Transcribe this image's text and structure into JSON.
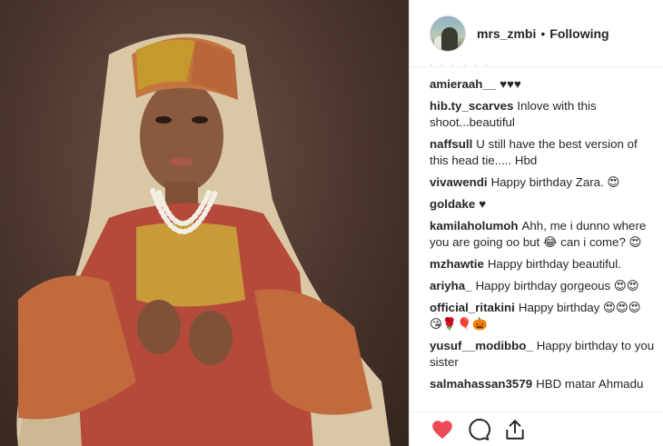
{
  "header": {
    "username": "mrs_zmbi",
    "separator": "•",
    "follow_status": "Following"
  },
  "comments": [
    {
      "user": "amieraah__",
      "text": "♥♥♥"
    },
    {
      "user": "hib.ty_scarves",
      "text": "Inlove with this shoot...beautiful"
    },
    {
      "user": "naffsull",
      "text": "U still have the best version of this head tie..... Hbd"
    },
    {
      "user": "vivawendi",
      "text": "Happy birthday Zara. 😍"
    },
    {
      "user": "goldake",
      "text": "♥"
    },
    {
      "user": "kamilaholumoh",
      "text": "Ahh, me i dunno where you are going oo but 😂 can i come? 😍"
    },
    {
      "user": "mzhawtie",
      "text": "Happy birthday beautiful."
    },
    {
      "user": "ariyha_",
      "text": "Happy birthday gorgeous 😍😍"
    },
    {
      "user": "official_ritakini",
      "text": "Happy birthday 😍😍😍 😘🌹🎈🎃"
    },
    {
      "user": "yusuf__modibbo_",
      "text": "Happy birthday to you sister"
    },
    {
      "user": "salmahassan3579",
      "text": "HBD matar Ahmadu"
    }
  ],
  "icons": {
    "like": "heart-icon",
    "comment": "comment-bubble-icon",
    "share": "share-icon"
  },
  "colors": {
    "like_red": "#ed4956",
    "border": "#efefef",
    "text": "#262626"
  }
}
